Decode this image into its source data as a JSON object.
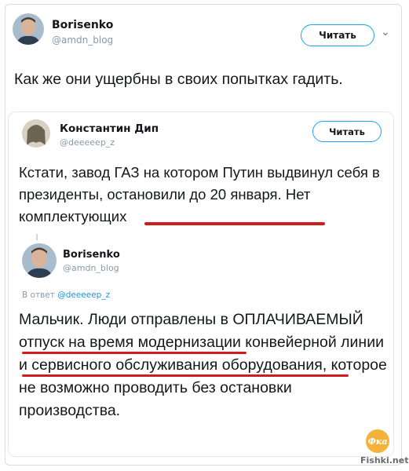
{
  "tweet": {
    "author_name": "Borisenko",
    "author_handle": "@amdn_blog",
    "follow_label": "Читать",
    "text": "Как же они ущербны в своих попытках гадить."
  },
  "quoted": {
    "author_name": "Константин Дип",
    "author_handle": "@deeeeep_z",
    "follow_label": "Читать",
    "text": "Кстати, завод ГАЗ на котором Путин выдвинул себя в президенты, остановили до 20 января. Нет комплектующих",
    "reply": {
      "author_name": "Borisenko",
      "author_handle": "@amdn_blog",
      "reply_prefix": "В ответ",
      "reply_to": "@deeeeep_z",
      "text": "Мальчик. Люди отправлены в ОПЛАЧИВАЕМЫЙ отпуск на время модернизации конвейерной линии и сервисного обслуживания оборудования, которое не возможно проводить без остановки производства."
    }
  },
  "watermark": "Fishki.net",
  "colors": {
    "accent": "#1da1f2",
    "underline": "#d01c1c",
    "handle": "#8899a6"
  }
}
